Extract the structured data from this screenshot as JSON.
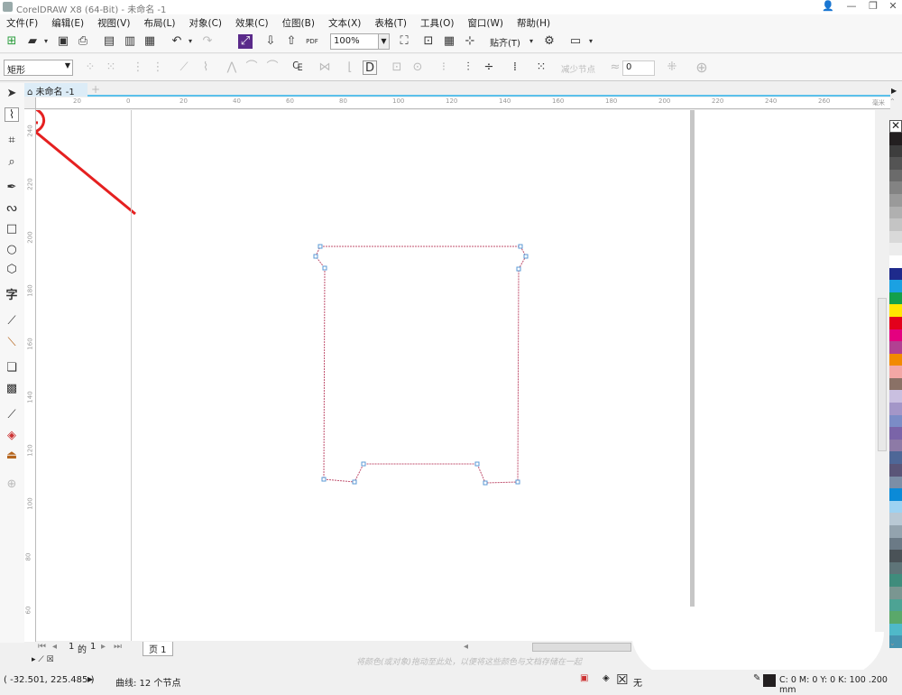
{
  "window": {
    "title": "CorelDRAW X8 (64-Bit) - 未命名 -1"
  },
  "menu": [
    "文件(F)",
    "编辑(E)",
    "视图(V)",
    "布局(L)",
    "对象(C)",
    "效果(C)",
    "位图(B)",
    "文本(X)",
    "表格(T)",
    "工具(O)",
    "窗口(W)",
    "帮助(H)"
  ],
  "toolbar": {
    "zoom_value": "100%",
    "snap_label": "贴齐(T)",
    "pdf_label": "PDF"
  },
  "propbar": {
    "shape_select": "矩形",
    "reduce_nodes": "减少节点",
    "smoothness_value": "0"
  },
  "doc_tab": {
    "label": "未命名 -1",
    "add": "+"
  },
  "ruler": {
    "unit": "毫米",
    "h_labels": [
      "20",
      "0",
      "20",
      "40",
      "60",
      "80",
      "100",
      "120",
      "140",
      "160",
      "180",
      "200",
      "220",
      "240",
      "260"
    ],
    "v_labels": [
      "240",
      "220",
      "200",
      "180",
      "160",
      "140",
      "120",
      "100",
      "80",
      "60"
    ]
  },
  "shape": {
    "nodes_count": 12,
    "outline_color": "#c0506e",
    "accent_color": "#5b9ad5"
  },
  "page_nav": {
    "current": "1",
    "of": "的",
    "total": "1",
    "page_tab": "页 1"
  },
  "color_hint": "将颜色(或对象)拖动至此处，以便将这些颜色与文档存储在一起",
  "status": {
    "coords": "( -32.501, 225.485 )",
    "selection": "曲线: 12 个节点",
    "fill_label": "无",
    "outline_info": "C: 0 M: 0 Y: 0 K: 100  .200 mm"
  },
  "palette": [
    "#231f20",
    "#3d3d3d",
    "#545454",
    "#6b6b6b",
    "#838383",
    "#9a9a9a",
    "#b0b0b0",
    "#c4c4c4",
    "#d9d9d9",
    "#ececec",
    "#ffffff",
    "#1e2a8c",
    "#1ba1e2",
    "#13a04a",
    "#ffe600",
    "#e3001b",
    "#e4007f",
    "#b24092",
    "#f28a00",
    "#f3a7a5",
    "#8a7166",
    "#c9bfe0",
    "#a396c8",
    "#7b8cc6",
    "#7a64a8",
    "#8d7aa6",
    "#4e6797",
    "#5a5578",
    "#7c8ea6",
    "#0b8ad7",
    "#9dd2f2",
    "#b8c8d4",
    "#93a3ae",
    "#6b7a86",
    "#4a5257",
    "#5e7478",
    "#3f8c7c",
    "#7a9691",
    "#4da394",
    "#5aa86a",
    "#4fb9c9",
    "#4694b0"
  ]
}
